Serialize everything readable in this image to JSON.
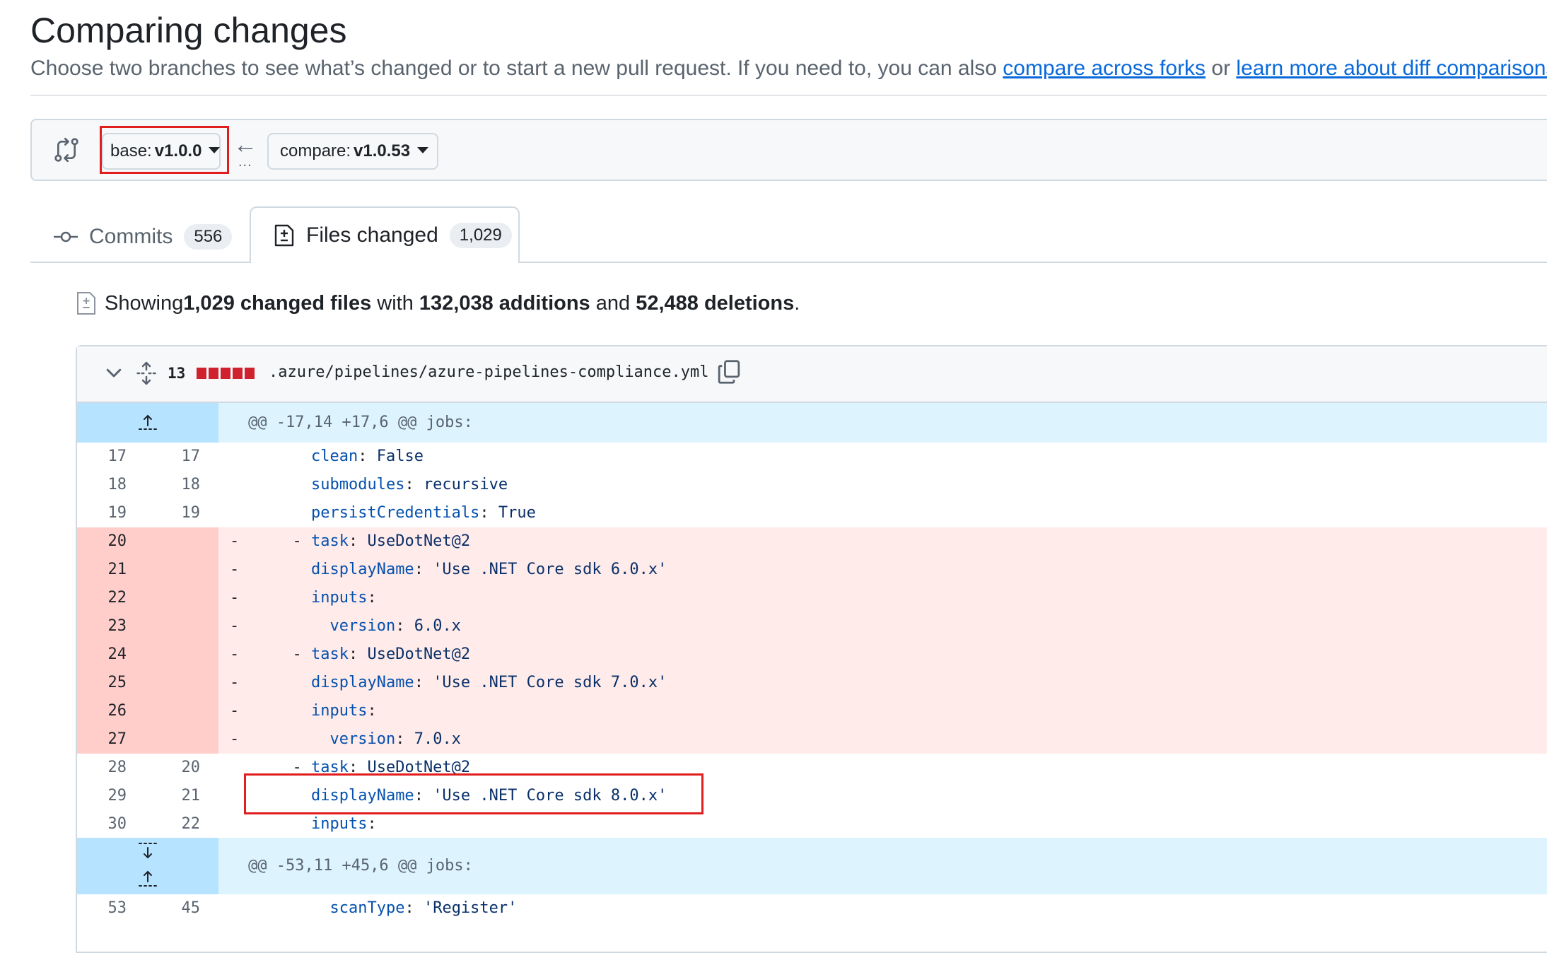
{
  "header": {
    "title": "Comparing changes",
    "subtitle_text": "Choose two branches to see what’s changed or to start a new pull request. If you need to, you can also ",
    "link_compare_forks": "compare across forks",
    "subtitle_or": " or ",
    "link_learn_more": "learn more about diff comparisons",
    "subtitle_end": "."
  },
  "range": {
    "base_label": "base:",
    "base_value": "v1.0.0",
    "arrow": "←",
    "dots": "...",
    "compare_label": "compare:",
    "compare_value": "v1.0.53"
  },
  "tabs": [
    {
      "label": "Commits",
      "count": "556",
      "icon": "git-commit-icon"
    },
    {
      "label": "Files changed",
      "count": "1,029",
      "icon": "file-diff-icon"
    }
  ],
  "summary": {
    "showing": "Showing ",
    "files": "1,029 changed files",
    "with": " with ",
    "additions": "132,038 additions",
    "and": " and ",
    "deletions": "52,488 deletions",
    "end": "."
  },
  "file": {
    "change_count": "13",
    "path": ".azure/pipelines/azure-pipelines-compliance.yml",
    "diffstat_color": "#cf222e"
  },
  "hunks": [
    {
      "header": "@@ -17,14 +17,6 @@ jobs:"
    },
    {
      "header": "@@ -53,11 +45,6 @@ jobs:"
    }
  ],
  "lines": [
    {
      "old": "17",
      "new": "17",
      "sign": " ",
      "key": "clean",
      "val": "False",
      "indent": "    "
    },
    {
      "old": "18",
      "new": "18",
      "sign": " ",
      "key": "submodules",
      "val": "recursive",
      "indent": "    "
    },
    {
      "old": "19",
      "new": "19",
      "sign": " ",
      "key": "persistCredentials",
      "val": "True",
      "indent": "    "
    },
    {
      "old": "20",
      "new": "",
      "sign": "-",
      "key": "task",
      "val": "UseDotNet@2",
      "indent": "  - "
    },
    {
      "old": "21",
      "new": "",
      "sign": "-",
      "key": "displayName",
      "val": "'Use .NET Core sdk 6.0.x'",
      "indent": "    "
    },
    {
      "old": "22",
      "new": "",
      "sign": "-",
      "key": "inputs",
      "val": "",
      "indent": "    "
    },
    {
      "old": "23",
      "new": "",
      "sign": "-",
      "key": "version",
      "val": "6.0.x",
      "indent": "      "
    },
    {
      "old": "24",
      "new": "",
      "sign": "-",
      "key": "task",
      "val": "UseDotNet@2",
      "indent": "  - "
    },
    {
      "old": "25",
      "new": "",
      "sign": "-",
      "key": "displayName",
      "val": "'Use .NET Core sdk 7.0.x'",
      "indent": "    "
    },
    {
      "old": "26",
      "new": "",
      "sign": "-",
      "key": "inputs",
      "val": "",
      "indent": "    "
    },
    {
      "old": "27",
      "new": "",
      "sign": "-",
      "key": "version",
      "val": "7.0.x",
      "indent": "      "
    },
    {
      "old": "28",
      "new": "20",
      "sign": " ",
      "key": "task",
      "val": "UseDotNet@2",
      "indent": "  - "
    },
    {
      "old": "29",
      "new": "21",
      "sign": " ",
      "key": "displayName",
      "val": "'Use .NET Core sdk 8.0.x'",
      "indent": "    "
    },
    {
      "old": "30",
      "new": "22",
      "sign": " ",
      "key": "inputs",
      "val": "",
      "indent": "    "
    }
  ],
  "lines2": [
    {
      "old": "53",
      "new": "45",
      "sign": " ",
      "key": "scanType",
      "val": "'Register'",
      "indent": "      "
    }
  ]
}
